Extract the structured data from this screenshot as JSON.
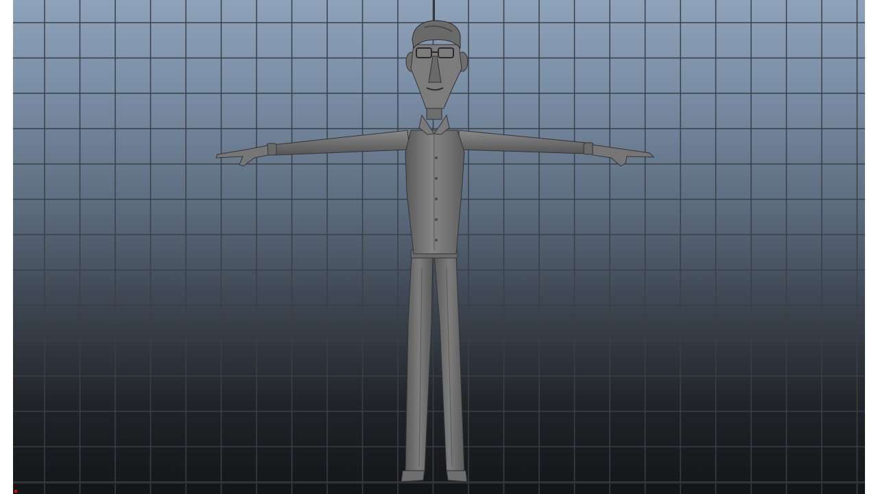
{
  "viewport": {
    "background_top": "#8ea2b9",
    "background_bottom": "#141517",
    "grid_color": "#3a3f46",
    "grid_center_line_color": "#2a2e33",
    "corner_marker_color": "#d01010"
  },
  "character": {
    "body_color": "#7a7a7a",
    "shadow_color": "#4a4a4a",
    "highlight_color": "#9a9a9a",
    "outline_color": "#2b2b2b"
  }
}
